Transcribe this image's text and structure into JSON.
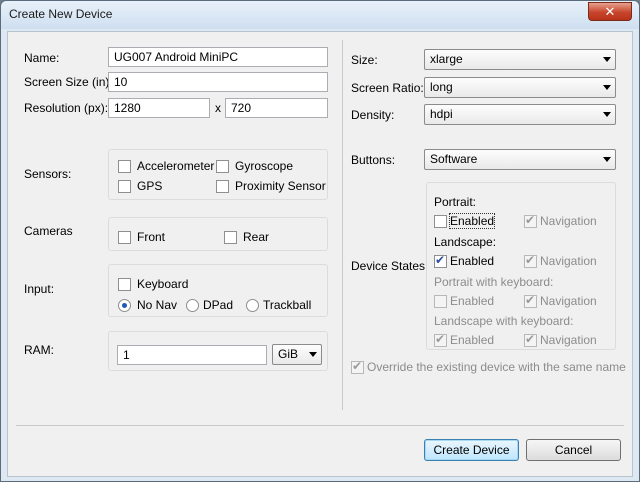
{
  "window": {
    "title": "Create New Device",
    "close_symbol": "✕"
  },
  "left": {
    "name_label": "Name:",
    "name_value": "UG007 Android MiniPC",
    "screen_size_label": "Screen Size (in):",
    "screen_size_value": "10",
    "resolution_label": "Resolution (px):",
    "resolution_width": "1280",
    "resolution_sep": "x",
    "resolution_height": "720",
    "sensors_label": "Sensors:",
    "sensors": {
      "accelerometer": "Accelerometer",
      "gyroscope": "Gyroscope",
      "gps": "GPS",
      "proximity": "Proximity Sensor"
    },
    "cameras_label": "Cameras",
    "cameras": {
      "front": "Front",
      "rear": "Rear"
    },
    "input_label": "Input:",
    "input": {
      "keyboard": "Keyboard",
      "nav_options": [
        "No Nav",
        "DPad",
        "Trackball"
      ],
      "nav_selected": "No Nav"
    },
    "ram_label": "RAM:",
    "ram_value": "1",
    "ram_unit": "GiB"
  },
  "right": {
    "size_label": "Size:",
    "size_value": "xlarge",
    "screen_ratio_label": "Screen Ratio:",
    "screen_ratio_value": "long",
    "density_label": "Density:",
    "density_value": "hdpi",
    "buttons_label": "Buttons:",
    "buttons_value": "Software",
    "device_states_label": "Device States:",
    "states": {
      "portrait": "Portrait:",
      "landscape": "Landscape:",
      "portrait_keyboard": "Portrait with keyboard:",
      "landscape_keyboard": "Landscape with keyboard:",
      "enabled": "Enabled",
      "navigation": "Navigation"
    },
    "override_label": "Override the existing device with the same name"
  },
  "footer": {
    "create_label": "Create Device",
    "cancel_label": "Cancel"
  }
}
